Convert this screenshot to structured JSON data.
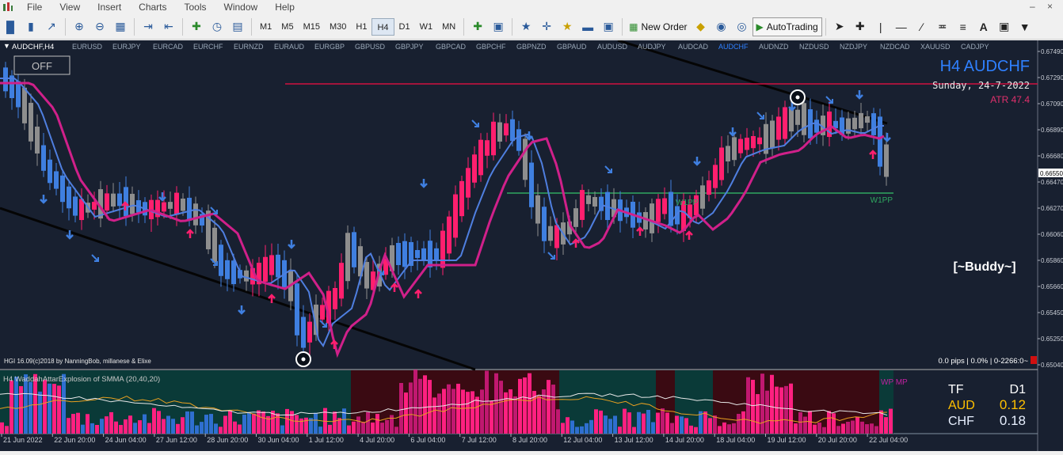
{
  "menubar": {
    "items": [
      "File",
      "View",
      "Insert",
      "Charts",
      "Tools",
      "Window",
      "Help"
    ]
  },
  "toolbar": {
    "timeframes": [
      "M1",
      "M5",
      "M15",
      "M30",
      "H1",
      "H4",
      "D1",
      "W1",
      "MN"
    ],
    "active_timeframe": "H4",
    "new_order_label": "New Order",
    "autotrading_label": "AutoTrading"
  },
  "chart": {
    "symbol_label": "AUDCHF,H4",
    "off_button": "OFF",
    "big_title": "H4 AUDCHF",
    "date_text": "Sunday, 24-7-2022",
    "atr_text": "ATR 47.4",
    "buddy_text": "[~Buddy~]",
    "w1pp_label": "W1PP",
    "w1pp_left_label": "W1PP",
    "footer_left": "HGI 16.09(c)2018 by NanningBob, millanese & Elixe",
    "footer_right": "0.0 pips | 0.0% | 0-2266:0~",
    "indicator_label": "H4 WaddahAttarExplosion of SMMA (20,40,20)",
    "indicator_right_label": "WP MP",
    "active_pair": "AUDCHF",
    "pairs": [
      "EURUSD",
      "EURJPY",
      "EURCAD",
      "EURCHF",
      "EURNZD",
      "EURAUD",
      "EURGBP",
      "GBPUSD",
      "GBPJPY",
      "GBPCAD",
      "GBPCHF",
      "GBPNZD",
      "GBPAUD",
      "AUDUSD",
      "AUDJPY",
      "AUDCAD",
      "AUDCHF",
      "AUDNZD",
      "NZDUSD",
      "NZDJPY",
      "NZDCAD",
      "XAUUSD",
      "CADJPY"
    ],
    "price_labels": [
      "0.67490",
      "0.67290",
      "0.67090",
      "0.66890",
      "0.66680",
      "0.66550",
      "0.66470",
      "0.66270",
      "0.66060",
      "0.65860",
      "0.65660",
      "0.65450",
      "0.65250",
      "0.65040"
    ],
    "current_price": "0.66550",
    "time_labels": [
      "21 Jun 2022",
      "22 Jun 20:00",
      "24 Jun 04:00",
      "27 Jun 12:00",
      "28 Jun 20:00",
      "30 Jun 04:00",
      "1 Jul 12:00",
      "4 Jul 20:00",
      "6 Jul 04:00",
      "7 Jul 12:00",
      "8 Jul 20:00",
      "12 Jul 04:00",
      "13 Jul 12:00",
      "14 Jul 20:00",
      "18 Jul 04:00",
      "19 Jul 12:00",
      "20 Jul 20:00",
      "22 Jul 04:00"
    ],
    "strength_panel": {
      "tf_label": "TF",
      "tf_value": "D1",
      "row1_name": "AUD",
      "row1_value": "0.12",
      "row2_name": "CHF",
      "row2_value": "0.18"
    }
  },
  "colors": {
    "background": "#182030",
    "bull": "#ff1f6e",
    "bear": "#3f7fe0",
    "neutral": "#8e8e8e",
    "ma_fast": "#4f7fe0",
    "ma_slow": "#d0208a",
    "resistance": "#d01040",
    "pivot": "#2fa860",
    "title_blue": "#2f80ff",
    "strength_yellow": "#ffc000"
  }
}
